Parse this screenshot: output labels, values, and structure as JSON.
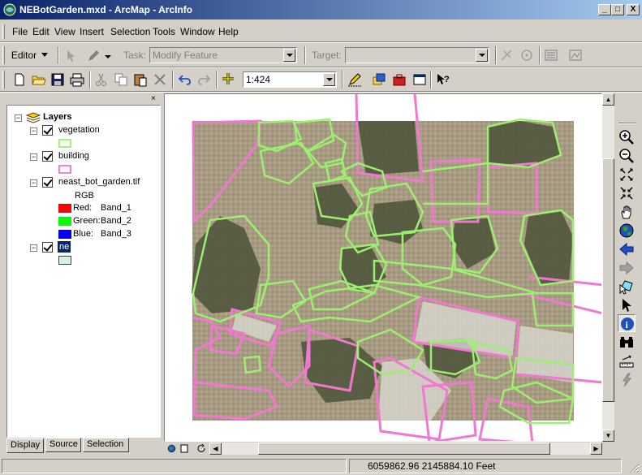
{
  "window": {
    "title": "NEBotGarden.mxd - ArcMap - ArcInfo",
    "minimize": "_",
    "maximize": "□",
    "close": "X"
  },
  "menu": [
    "File",
    "Edit",
    "View",
    "Insert",
    "Selection",
    "Tools",
    "Window",
    "Help"
  ],
  "editor_toolbar": {
    "editor_label": "Editor",
    "task_label": "Task:",
    "task_value": "Modify Feature",
    "target_label": "Target:",
    "target_value": ""
  },
  "main_toolbar": {
    "scale_value": "1:424"
  },
  "toc": {
    "close": "×",
    "root": "Layers",
    "layers": [
      {
        "name": "vegetation",
        "checked": true,
        "symbol_color": "#a8f080"
      },
      {
        "name": "building",
        "checked": true,
        "symbol_color": "#f080d0"
      },
      {
        "name": "neast_bot_garden.tif",
        "checked": true
      },
      {
        "name": "ne",
        "checked": true,
        "symbol_color": "#d8f0e0"
      }
    ],
    "raster_legend": {
      "rgb_label": "RGB",
      "bands": [
        {
          "label": "Red:",
          "band": "Band_1",
          "color": "#ff0000"
        },
        {
          "label": "Green:",
          "band": "Band_2",
          "color": "#00ff00"
        },
        {
          "label": "Blue:",
          "band": "Band_3",
          "color": "#0000ff"
        }
      ]
    },
    "tabs": [
      "Display",
      "Source",
      "Selection"
    ]
  },
  "status": {
    "coordinates": "6059862.96  2145884.10 Feet"
  },
  "colors": {
    "title_start": "#0a246a",
    "title_end": "#a6caf0",
    "vegetation_outline": "#9cf070",
    "building_outline": "#f078d0",
    "chrome": "#d4d0c8"
  }
}
